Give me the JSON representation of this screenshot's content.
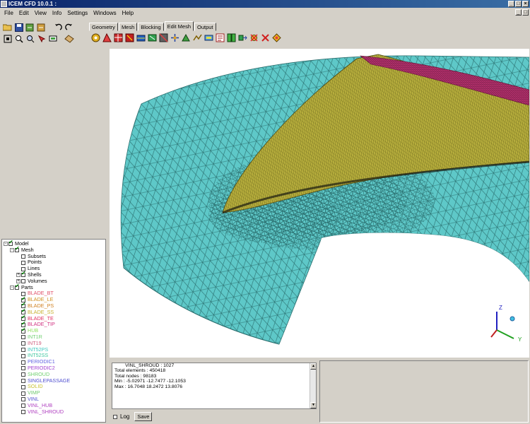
{
  "window": {
    "title": "ICEM CFD 10.0.1 :",
    "buttons": [
      "_",
      "□",
      "×"
    ],
    "mdi_buttons": [
      "_",
      "□"
    ]
  },
  "menu": [
    "File",
    "Edit",
    "View",
    "Info",
    "Settings",
    "Windows",
    "Help"
  ],
  "tabs": [
    "Geometry",
    "Mesh",
    "Blocking",
    "Edit Mesh",
    "Output"
  ],
  "active_tab": "Edit Mesh",
  "toolbar_left_row1": [
    "open-icon",
    "save-icon",
    "import-icon",
    "export-icon",
    "undo-icon",
    "redo-icon"
  ],
  "toolbar_left_row2": [
    "fit-icon",
    "zoom-icon",
    "measure-icon",
    "pick-icon",
    "display-icon",
    "refresh-icon"
  ],
  "toolbar_edit_mesh": [
    "check-mesh-icon",
    "display-quality-icon",
    "smooth-icon",
    "smooth-hexa-icon",
    "repair-icon",
    "merge-nodes-icon",
    "split-mesh-icon",
    "move-nodes-icon",
    "transform-icon",
    "convert-icon",
    "adjust-thickness-icon",
    "renumber-icon",
    "bandwidth-icon",
    "extrude-icon",
    "delete-nodes-icon",
    "delete-elements-icon",
    "edit-distribution-icon"
  ],
  "tree": [
    {
      "label": "Model",
      "level": 0,
      "expander": "-",
      "checkbox": "checked",
      "color": "#000000"
    },
    {
      "label": "Mesh",
      "level": 1,
      "expander": "-",
      "checkbox": "checked",
      "color": "#000000"
    },
    {
      "label": "Subsets",
      "level": 2,
      "expander": "",
      "checkbox": "empty",
      "color": "#000000"
    },
    {
      "label": "Points",
      "level": 2,
      "expander": "",
      "checkbox": "empty",
      "color": "#000000"
    },
    {
      "label": "Lines",
      "level": 2,
      "expander": "",
      "checkbox": "empty",
      "color": "#000000"
    },
    {
      "label": "Shells",
      "level": 2,
      "expander": "+",
      "checkbox": "checked",
      "color": "#000000"
    },
    {
      "label": "Volumes",
      "level": 2,
      "expander": "+",
      "checkbox": "empty",
      "color": "#000000"
    },
    {
      "label": "Parts",
      "level": 1,
      "expander": "-",
      "checkbox": "checked",
      "color": "#000000"
    },
    {
      "label": "BLADE_BT",
      "level": 2,
      "expander": "",
      "checkbox": "empty",
      "color": "#e0506a"
    },
    {
      "label": "BLADE_LE",
      "level": 2,
      "expander": "",
      "checkbox": "checked",
      "color": "#d09020"
    },
    {
      "label": "BLADE_PS",
      "level": 2,
      "expander": "",
      "checkbox": "checked",
      "color": "#d08020"
    },
    {
      "label": "BLADE_SS",
      "level": 2,
      "expander": "",
      "checkbox": "checked",
      "color": "#c8b030"
    },
    {
      "label": "BLADE_TE",
      "level": 2,
      "expander": "",
      "checkbox": "checked",
      "color": "#e03060"
    },
    {
      "label": "BLADE_TIP",
      "level": 2,
      "expander": "",
      "checkbox": "checked",
      "color": "#d03080"
    },
    {
      "label": "HUB",
      "level": 2,
      "expander": "",
      "checkbox": "checked",
      "color": "#90e060"
    },
    {
      "label": "INT1R",
      "level": 2,
      "expander": "",
      "checkbox": "empty",
      "color": "#70d070"
    },
    {
      "label": "INT19",
      "level": 2,
      "expander": "",
      "checkbox": "empty",
      "color": "#d06080"
    },
    {
      "label": "INT52PS",
      "level": 2,
      "expander": "",
      "checkbox": "empty",
      "color": "#40c8c0"
    },
    {
      "label": "INT52SS",
      "level": 2,
      "expander": "",
      "checkbox": "empty",
      "color": "#40c8a0"
    },
    {
      "label": "PERIODIC1",
      "level": 2,
      "expander": "",
      "checkbox": "empty",
      "color": "#6060e0"
    },
    {
      "label": "PERIODIC2",
      "level": 2,
      "expander": "",
      "checkbox": "empty",
      "color": "#a040d0"
    },
    {
      "label": "SHROUD",
      "level": 2,
      "expander": "",
      "checkbox": "empty",
      "color": "#70d070"
    },
    {
      "label": "SINGLEPASSAGE",
      "level": 2,
      "expander": "",
      "checkbox": "empty",
      "color": "#5050d0"
    },
    {
      "label": "SOLID",
      "level": 2,
      "expander": "",
      "checkbox": "empty",
      "color": "#c8c030"
    },
    {
      "label": "VIMP",
      "level": 2,
      "expander": "",
      "checkbox": "empty",
      "color": "#70c870"
    },
    {
      "label": "VINL",
      "level": 2,
      "expander": "",
      "checkbox": "empty",
      "color": "#5050d0"
    },
    {
      "label": "VINL_HUB",
      "level": 2,
      "expander": "",
      "checkbox": "empty",
      "color": "#b040c0"
    },
    {
      "label": "VINL_SHROUD",
      "level": 2,
      "expander": "",
      "checkbox": "empty",
      "color": "#b040c0"
    }
  ],
  "messages": [
    "        VINL_SHROUD : 1027",
    "Total elements : 450418",
    "Total nodes : 98183",
    "Min : -5.02971 -12.7477 -12.1053",
    "Max : 16.7048 18.2472 13.8076"
  ],
  "log_label": "Log",
  "save_label": "Save",
  "axes": {
    "z": "Z",
    "y": "Y"
  },
  "colors": {
    "mesh_cyan": "#5ec8c8",
    "blade_yellow": "#b6ad3c",
    "blade_tip_magenta": "#b0306a",
    "title_blue": "#0a246a"
  }
}
